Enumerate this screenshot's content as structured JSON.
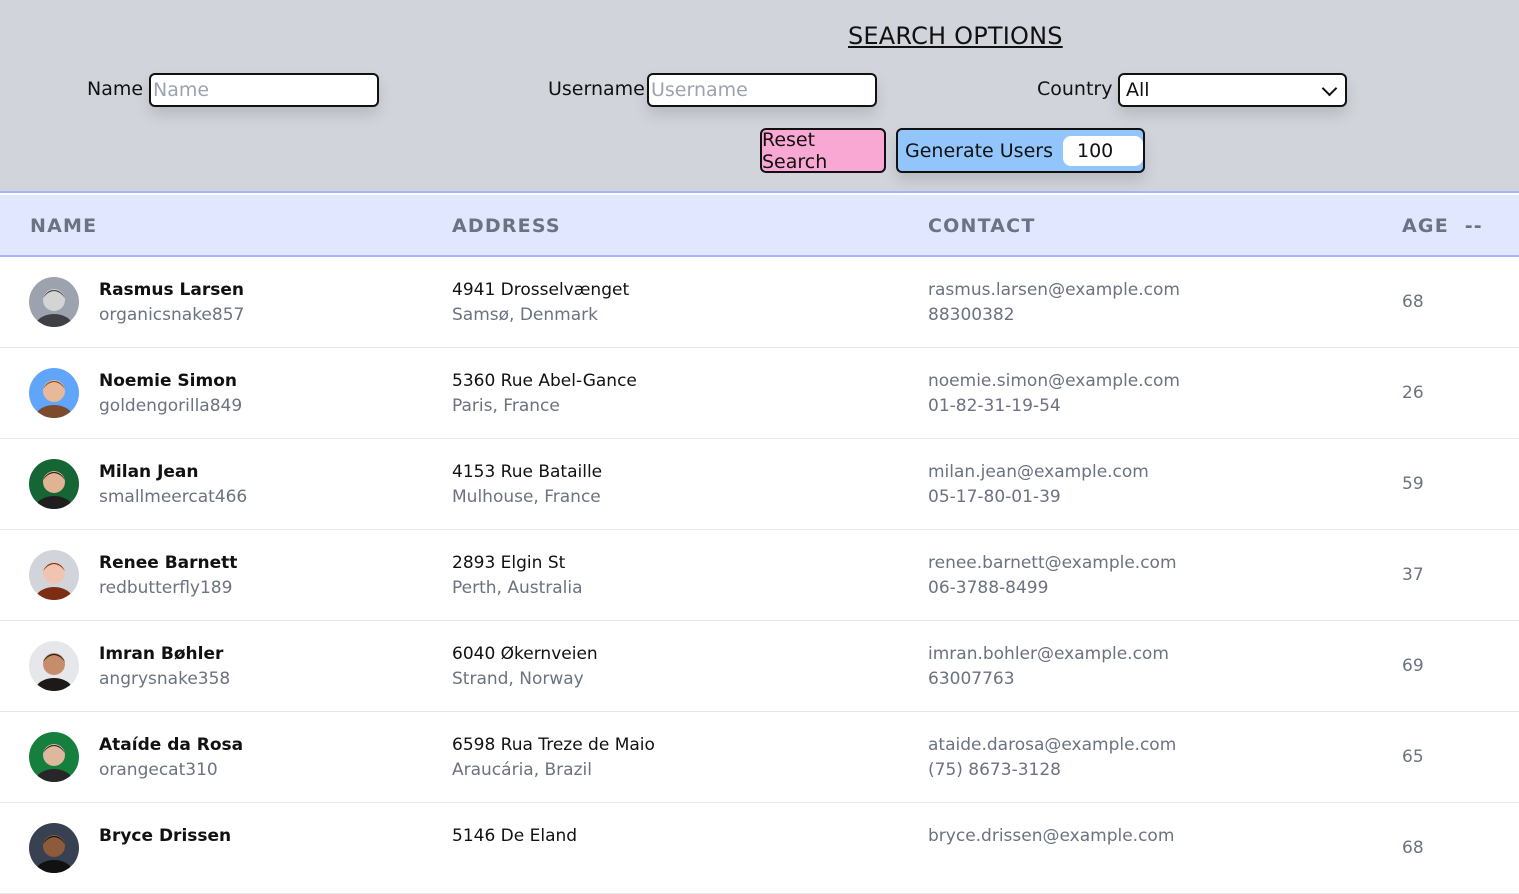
{
  "search": {
    "title": "SEARCH OPTIONS",
    "name_label": "Name",
    "name_placeholder": "Name",
    "username_label": "Username",
    "username_placeholder": "Username",
    "country_label": "Country",
    "country_value": "All",
    "reset_label": "Reset Search",
    "generate_label": "Generate Users",
    "generate_count": "100"
  },
  "table": {
    "headers": {
      "name": "NAME",
      "address": "ADDRESS",
      "contact": "CONTACT",
      "age": "AGE",
      "age_sort": "--"
    },
    "rows": [
      {
        "name": "Rasmus Larsen",
        "username": "organicsnake857",
        "street": "4941 Drosselvænget",
        "city": "Samsø, Denmark",
        "email": "rasmus.larsen@example.com",
        "phone": "88300382",
        "age": "68",
        "avatar": {
          "bg": "#9ca3af",
          "skin": "#d4d4d4",
          "hair": "#3f3f46"
        }
      },
      {
        "name": "Noemie Simon",
        "username": "goldengorilla849",
        "street": "5360 Rue Abel-Gance",
        "city": "Paris, France",
        "email": "noemie.simon@example.com",
        "phone": "01-82-31-19-54",
        "age": "26",
        "avatar": {
          "bg": "#60a5fa",
          "skin": "#e8b89a",
          "hair": "#7c4a2d"
        }
      },
      {
        "name": "Milan Jean",
        "username": "smallmeercat466",
        "street": "4153 Rue Bataille",
        "city": "Mulhouse, France",
        "email": "milan.jean@example.com",
        "phone": "05-17-80-01-39",
        "age": "59",
        "avatar": {
          "bg": "#166534",
          "skin": "#e0b393",
          "hair": "#1f1f1f"
        }
      },
      {
        "name": "Renee Barnett",
        "username": "redbutterfly189",
        "street": "2893 Elgin St",
        "city": "Perth, Australia",
        "email": "renee.barnett@example.com",
        "phone": "06-3788-8499",
        "age": "37",
        "avatar": {
          "bg": "#d1d5db",
          "skin": "#f1c4b2",
          "hair": "#7c2d12"
        }
      },
      {
        "name": "Imran Bøhler",
        "username": "angrysnake358",
        "street": "6040 Økernveien",
        "city": "Strand, Norway",
        "email": "imran.bohler@example.com",
        "phone": "63007763",
        "age": "69",
        "avatar": {
          "bg": "#e5e7eb",
          "skin": "#c68d6a",
          "hair": "#1c1917"
        }
      },
      {
        "name": "Ataíde da Rosa",
        "username": "orangecat310",
        "street": "6598 Rua Treze de Maio",
        "city": "Araucária, Brazil",
        "email": "ataide.darosa@example.com",
        "phone": "(75) 8673-3128",
        "age": "65",
        "avatar": {
          "bg": "#15803d",
          "skin": "#deb89c",
          "hair": "#27272a"
        }
      },
      {
        "name": "Bryce Drissen",
        "username": "",
        "street": "5146 De Eland",
        "city": "",
        "email": "bryce.drissen@example.com",
        "phone": "",
        "age": "68",
        "avatar": {
          "bg": "#374151",
          "skin": "#8d5a3b",
          "hair": "#111111"
        }
      }
    ]
  }
}
